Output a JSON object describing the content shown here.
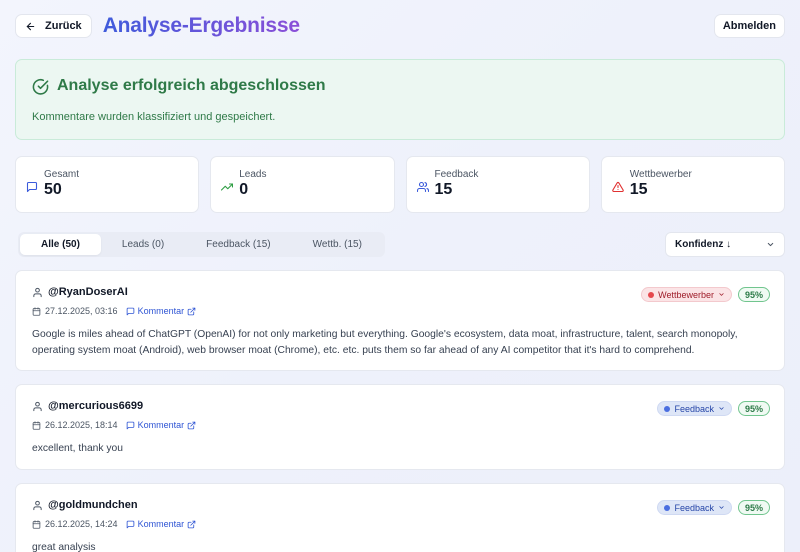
{
  "header": {
    "back_label": "Zurück",
    "title": "Analyse-Ergebnisse",
    "logout_label": "Abmelden"
  },
  "success": {
    "title": "Analyse erfolgreich abgeschlossen",
    "text": "Kommentare wurden klassifiziert und gespeichert."
  },
  "stats": [
    {
      "label": "Gesamt",
      "value": "50",
      "icon": "message-icon",
      "color": "#3b5bdb"
    },
    {
      "label": "Leads",
      "value": "0",
      "icon": "trend-up-icon",
      "color": "#2f9e44"
    },
    {
      "label": "Feedback",
      "value": "15",
      "icon": "users-icon",
      "color": "#3b5bdb"
    },
    {
      "label": "Wettbewerber",
      "value": "15",
      "icon": "warning-icon",
      "color": "#e03131"
    }
  ],
  "tabs": [
    {
      "label": "Alle (50)",
      "active": true
    },
    {
      "label": "Leads (0)"
    },
    {
      "label": "Feedback (15)"
    },
    {
      "label": "Wettb. (15)"
    }
  ],
  "sort": {
    "label": "Konfidenz ↓"
  },
  "comments": [
    {
      "author": "@RyanDoserAI",
      "date": "27.12.2025, 03:16",
      "link_label": "Kommentar",
      "category": "Wettbewerber",
      "confidence": "95%",
      "text": "Google is miles ahead of ChatGPT (OpenAI) for not only marketing but everything. Google's ecosystem, data moat, infrastructure, talent, search monopoly, operating system moat (Android), web browser moat (Chrome), etc. etc. puts them so far ahead of any AI competitor that it's hard to comprehend."
    },
    {
      "author": "@mercurious6699",
      "date": "26.12.2025, 18:14",
      "link_label": "Kommentar",
      "category": "Feedback",
      "confidence": "95%",
      "text": "excellent, thank you"
    },
    {
      "author": "@goldmundchen",
      "date": "26.12.2025, 14:24",
      "link_label": "Kommentar",
      "category": "Feedback",
      "confidence": "95%",
      "text": "great analysis"
    }
  ]
}
